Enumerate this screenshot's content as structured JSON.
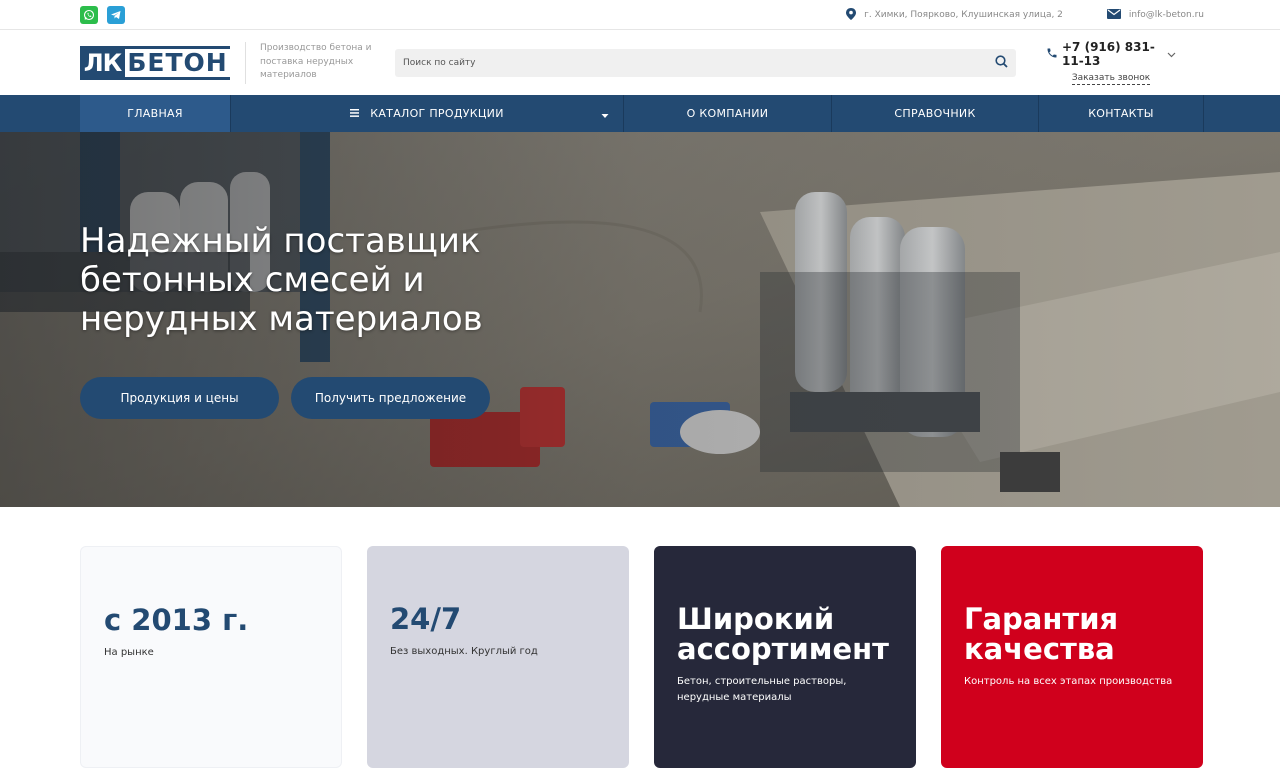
{
  "topbar": {
    "address": "г. Химки, Поярково, Клушинская улица, 2",
    "email": "info@lk-beton.ru"
  },
  "header": {
    "logo_left": "ЛК",
    "logo_right": "БЕТОН",
    "slogan": "Производство бетона и поставка нерудных материалов",
    "search_placeholder": "Поиск по сайту",
    "phone": "+7 (916) 831-11-13",
    "callback": "Заказать звонок"
  },
  "nav": {
    "items": [
      {
        "label": "ГЛАВНАЯ"
      },
      {
        "label": "КАТАЛОГ ПРОДУКЦИИ"
      },
      {
        "label": "О КОМПАНИИ"
      },
      {
        "label": "СПРАВОЧНИК"
      },
      {
        "label": "КОНТАКТЫ"
      }
    ]
  },
  "hero": {
    "title": "Надежный поставщик бетонных смесей и нерудных материалов",
    "button_primary": "Продукция и цены",
    "button_secondary": "Получить предложение"
  },
  "features": [
    {
      "title": "с 2013 г.",
      "text": "На рынке"
    },
    {
      "title": "24/7",
      "text": "Без выходных. Круглый год"
    },
    {
      "title": "Широкий ассортимент",
      "text": "Бетон, строительные растворы, нерудные материалы"
    },
    {
      "title": "Гарантия качества",
      "text": "Контроль на всех этапах производства"
    }
  ],
  "colors": {
    "brand": "#234a72",
    "nav_active": "#2d5a8b",
    "card_dark": "#26283a",
    "card_red": "#d0001c",
    "card_grey": "#d5d6e0",
    "whatsapp": "#2cbd4b",
    "telegram": "#2a9fd6"
  },
  "icons": [
    "whatsapp-icon",
    "telegram-icon",
    "location-pin-icon",
    "mail-icon",
    "search-icon",
    "phone-icon",
    "chevron-down-icon",
    "menu-icon"
  ]
}
